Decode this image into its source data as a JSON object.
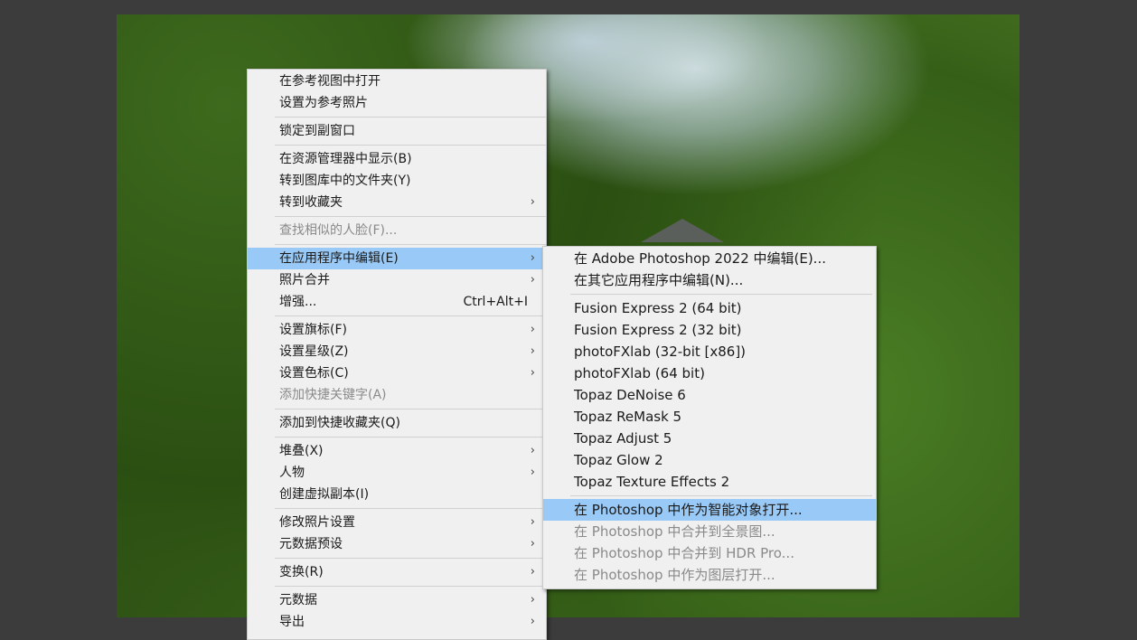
{
  "main_menu": {
    "items": [
      {
        "label": "在参考视图中打开",
        "submenu": false
      },
      {
        "label": "设置为参考照片",
        "submenu": false
      },
      {
        "label": "锁定到副窗口",
        "submenu": false
      },
      {
        "label": "在资源管理器中显示(B)",
        "submenu": false
      },
      {
        "label": "转到图库中的文件夹(Y)",
        "submenu": false
      },
      {
        "label": "转到收藏夹",
        "submenu": true
      },
      {
        "label": "查找相似的人脸(F)...",
        "submenu": false,
        "disabled": true
      },
      {
        "label": "在应用程序中编辑(E)",
        "submenu": true,
        "highlight": true
      },
      {
        "label": "照片合并",
        "submenu": true
      },
      {
        "label": "增强...",
        "submenu": false,
        "shortcut": "Ctrl+Alt+I"
      },
      {
        "label": "设置旗标(F)",
        "submenu": true
      },
      {
        "label": "设置星级(Z)",
        "submenu": true
      },
      {
        "label": "设置色标(C)",
        "submenu": true
      },
      {
        "label": "添加快捷关键字(A)",
        "submenu": false,
        "disabled": true
      },
      {
        "label": "添加到快捷收藏夹(Q)",
        "submenu": false
      },
      {
        "label": "堆叠(X)",
        "submenu": true
      },
      {
        "label": "人物",
        "submenu": true
      },
      {
        "label": "创建虚拟副本(I)",
        "submenu": false
      },
      {
        "label": "修改照片设置",
        "submenu": true
      },
      {
        "label": "元数据预设",
        "submenu": true
      },
      {
        "label": "变换(R)",
        "submenu": true
      },
      {
        "label": "元数据",
        "submenu": true
      },
      {
        "label": "导出",
        "submenu": true
      }
    ]
  },
  "sub_menu": {
    "items": [
      {
        "label": "在 Adobe Photoshop 2022 中编辑(E)..."
      },
      {
        "label": "在其它应用程序中编辑(N)..."
      },
      {
        "label": "Fusion Express 2 (64 bit)"
      },
      {
        "label": "Fusion Express 2 (32 bit)"
      },
      {
        "label": "photoFXlab (32-bit [x86])"
      },
      {
        "label": "photoFXlab (64 bit)"
      },
      {
        "label": "Topaz DeNoise 6"
      },
      {
        "label": "Topaz ReMask 5"
      },
      {
        "label": "Topaz Adjust 5"
      },
      {
        "label": "Topaz Glow 2"
      },
      {
        "label": "Topaz Texture Effects 2"
      },
      {
        "label": "在 Photoshop 中作为智能对象打开...",
        "highlight": true
      },
      {
        "label": "在 Photoshop 中合并到全景图...",
        "disabled": true
      },
      {
        "label": "在 Photoshop 中合并到 HDR Pro...",
        "disabled": true
      },
      {
        "label": "在 Photoshop 中作为图层打开...",
        "disabled": true
      }
    ]
  },
  "colors": {
    "menu_bg": "#f0f0f0",
    "highlight": "#99c9f6",
    "disabled_text": "#8a8a8a",
    "workspace_bg": "#3c3c3c"
  },
  "icons": {
    "submenu_arrow": "chevron-right-icon"
  }
}
